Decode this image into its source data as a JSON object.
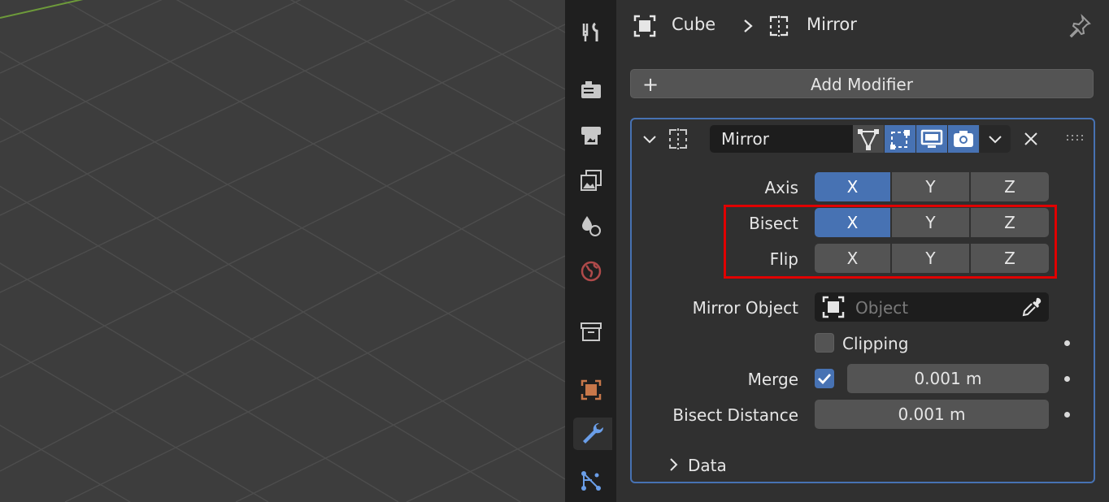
{
  "breadcrumb": {
    "object": "Cube",
    "modifier": "Mirror"
  },
  "add_modifier": {
    "label": "Add Modifier",
    "plus": "+"
  },
  "modifier": {
    "name": "Mirror",
    "axis": {
      "label": "Axis",
      "options": [
        "X",
        "Y",
        "Z"
      ],
      "active": [
        "X"
      ]
    },
    "bisect": {
      "label": "Bisect",
      "options": [
        "X",
        "Y",
        "Z"
      ],
      "active": [
        "X"
      ]
    },
    "flip": {
      "label": "Flip",
      "options": [
        "X",
        "Y",
        "Z"
      ],
      "active": []
    },
    "mirror_object": {
      "label": "Mirror Object",
      "placeholder": "Object"
    },
    "clipping": {
      "label": "Clipping",
      "checked": false
    },
    "merge": {
      "label": "Merge",
      "checked": true,
      "value": "0.001 m"
    },
    "bisect_distance": {
      "label": "Bisect Distance",
      "value": "0.001 m"
    },
    "data_section": {
      "label": "Data"
    }
  },
  "colors": {
    "accent": "#4772b3",
    "highlight": "#e00000",
    "object_orange": "#c8784a",
    "world_red": "#b04a4a"
  }
}
